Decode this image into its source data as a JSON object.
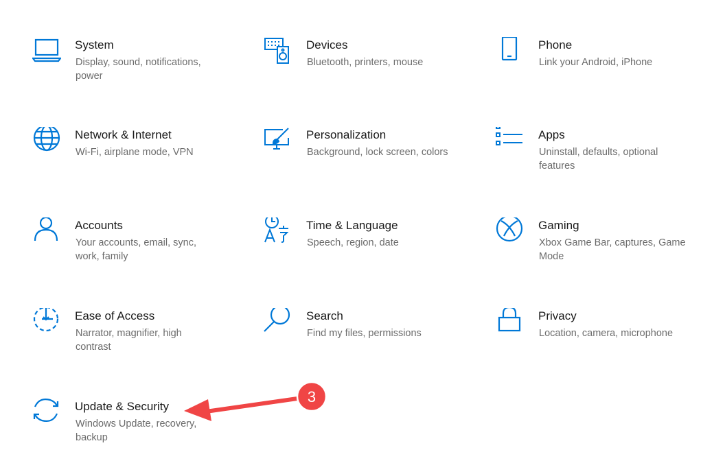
{
  "accent_color": "#0078d7",
  "annotation_color": "#f04545",
  "tiles": [
    {
      "title": "System",
      "desc": "Display, sound, notifications, power",
      "icon": "laptop-icon"
    },
    {
      "title": "Devices",
      "desc": "Bluetooth, printers, mouse",
      "icon": "keyboard-speaker-icon"
    },
    {
      "title": "Phone",
      "desc": "Link your Android, iPhone",
      "icon": "phone-icon"
    },
    {
      "title": "Network & Internet",
      "desc": "Wi-Fi, airplane mode, VPN",
      "icon": "globe-icon"
    },
    {
      "title": "Personalization",
      "desc": "Background, lock screen, colors",
      "icon": "paintbrush-monitor-icon"
    },
    {
      "title": "Apps",
      "desc": "Uninstall, defaults, optional features",
      "icon": "app-list-icon"
    },
    {
      "title": "Accounts",
      "desc": "Your accounts, email, sync, work, family",
      "icon": "person-icon"
    },
    {
      "title": "Time & Language",
      "desc": "Speech, region, date",
      "icon": "time-language-icon"
    },
    {
      "title": "Gaming",
      "desc": "Xbox Game Bar, captures, Game Mode",
      "icon": "xbox-icon"
    },
    {
      "title": "Ease of Access",
      "desc": "Narrator, magnifier, high contrast",
      "icon": "ease-of-access-icon"
    },
    {
      "title": "Search",
      "desc": "Find my files, permissions",
      "icon": "magnifier-icon"
    },
    {
      "title": "Privacy",
      "desc": "Location, camera, microphone",
      "icon": "lock-icon"
    },
    {
      "title": "Update & Security",
      "desc": "Windows Update, recovery, backup",
      "icon": "sync-arrows-icon"
    }
  ],
  "annotation": {
    "badge_number": "3"
  }
}
